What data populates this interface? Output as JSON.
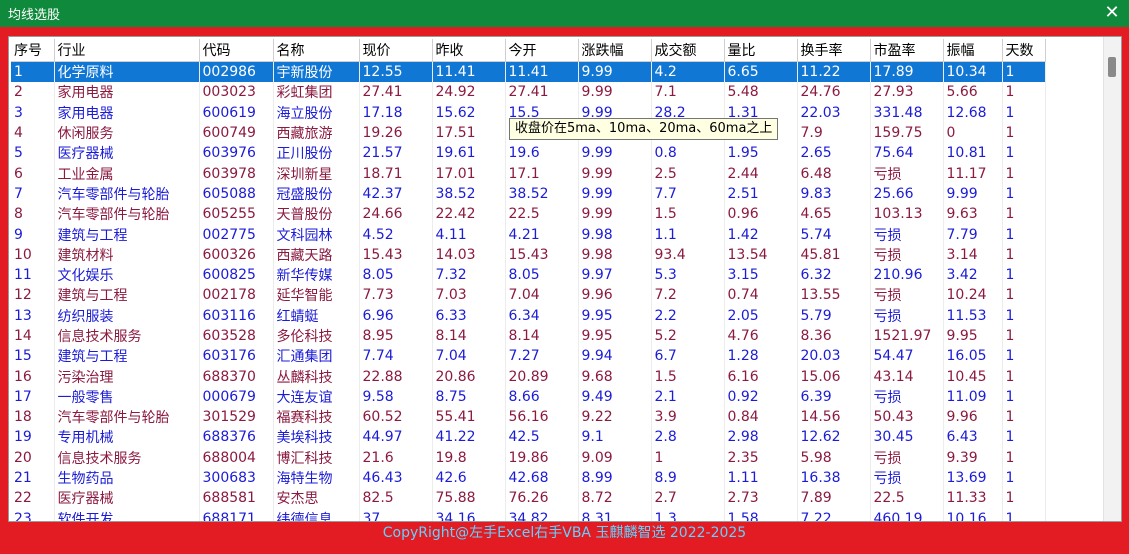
{
  "window": {
    "title": "均线选股"
  },
  "tooltip": "收盘价在5ma、10ma、20ma、60ma之上",
  "footer": "CopyRight@左手Excel右手VBA 玉麒麟智选  2022-2025",
  "columns": [
    "序号",
    "行业",
    "代码",
    "名称",
    "现价",
    "昨收",
    "今开",
    "涨跌幅",
    "成交额",
    "量比",
    "换手率",
    "市盈率",
    "振幅",
    "天数"
  ],
  "rows": [
    [
      "1",
      "化学原料",
      "002986",
      "宇新股份",
      "12.55",
      "11.41",
      "11.41",
      "9.99",
      "4.2",
      "6.65",
      "11.22",
      "17.89",
      "10.34",
      "1"
    ],
    [
      "2",
      "家用电器",
      "003023",
      "彩虹集团",
      "27.41",
      "24.92",
      "27.41",
      "9.99",
      "7.1",
      "5.48",
      "24.76",
      "27.93",
      "5.66",
      "1"
    ],
    [
      "3",
      "家用电器",
      "600619",
      "海立股份",
      "17.18",
      "15.62",
      "15.5",
      "9.99",
      "28.2",
      "1.31",
      "22.03",
      "331.48",
      "12.68",
      "1"
    ],
    [
      "4",
      "休闲服务",
      "600749",
      "西藏旅游",
      "19.26",
      "17.51",
      "1",
      "",
      "",
      "",
      "7.9",
      "159.75",
      "0",
      "1"
    ],
    [
      "5",
      "医疗器械",
      "603976",
      "正川股份",
      "21.57",
      "19.61",
      "19.6",
      "9.99",
      "0.8",
      "1.95",
      "2.65",
      "75.64",
      "10.81",
      "1"
    ],
    [
      "6",
      "工业金属",
      "603978",
      "深圳新星",
      "18.71",
      "17.01",
      "17.1",
      "9.99",
      "2.5",
      "2.44",
      "6.48",
      "亏损",
      "11.17",
      "1"
    ],
    [
      "7",
      "汽车零部件与轮胎",
      "605088",
      "冠盛股份",
      "42.37",
      "38.52",
      "38.52",
      "9.99",
      "7.7",
      "2.51",
      "9.83",
      "25.66",
      "9.99",
      "1"
    ],
    [
      "8",
      "汽车零部件与轮胎",
      "605255",
      "天普股份",
      "24.66",
      "22.42",
      "22.5",
      "9.99",
      "1.5",
      "0.96",
      "4.65",
      "103.13",
      "9.63",
      "1"
    ],
    [
      "9",
      "建筑与工程",
      "002775",
      "文科园林",
      "4.52",
      "4.11",
      "4.21",
      "9.98",
      "1.1",
      "1.42",
      "5.74",
      "亏损",
      "7.79",
      "1"
    ],
    [
      "10",
      "建筑材料",
      "600326",
      "西藏天路",
      "15.43",
      "14.03",
      "15.43",
      "9.98",
      "93.4",
      "13.54",
      "45.81",
      "亏损",
      "3.14",
      "1"
    ],
    [
      "11",
      "文化娱乐",
      "600825",
      "新华传媒",
      "8.05",
      "7.32",
      "8.05",
      "9.97",
      "5.3",
      "3.15",
      "6.32",
      "210.96",
      "3.42",
      "1"
    ],
    [
      "12",
      "建筑与工程",
      "002178",
      "延华智能",
      "7.73",
      "7.03",
      "7.04",
      "9.96",
      "7.2",
      "0.74",
      "13.55",
      "亏损",
      "10.24",
      "1"
    ],
    [
      "13",
      "纺织服装",
      "603116",
      "红蜻蜓",
      "6.96",
      "6.33",
      "6.34",
      "9.95",
      "2.2",
      "2.05",
      "5.79",
      "亏损",
      "11.53",
      "1"
    ],
    [
      "14",
      "信息技术服务",
      "603528",
      "多伦科技",
      "8.95",
      "8.14",
      "8.14",
      "9.95",
      "5.2",
      "4.76",
      "8.36",
      "1521.97",
      "9.95",
      "1"
    ],
    [
      "15",
      "建筑与工程",
      "603176",
      "汇通集团",
      "7.74",
      "7.04",
      "7.27",
      "9.94",
      "6.7",
      "1.28",
      "20.03",
      "54.47",
      "16.05",
      "1"
    ],
    [
      "16",
      "污染治理",
      "688370",
      "丛麟科技",
      "22.88",
      "20.86",
      "20.89",
      "9.68",
      "1.5",
      "6.16",
      "15.06",
      "43.14",
      "10.45",
      "1"
    ],
    [
      "17",
      "一般零售",
      "000679",
      "大连友谊",
      "9.58",
      "8.75",
      "8.66",
      "9.49",
      "2.1",
      "0.92",
      "6.39",
      "亏损",
      "11.09",
      "1"
    ],
    [
      "18",
      "汽车零部件与轮胎",
      "301529",
      "福赛科技",
      "60.52",
      "55.41",
      "56.16",
      "9.22",
      "3.9",
      "0.84",
      "14.56",
      "50.43",
      "9.96",
      "1"
    ],
    [
      "19",
      "专用机械",
      "688376",
      "美埃科技",
      "44.97",
      "41.22",
      "42.5",
      "9.1",
      "2.8",
      "2.98",
      "12.62",
      "30.45",
      "6.43",
      "1"
    ],
    [
      "20",
      "信息技术服务",
      "688004",
      "博汇科技",
      "21.6",
      "19.8",
      "19.86",
      "9.09",
      "1",
      "2.35",
      "5.98",
      "亏损",
      "9.39",
      "1"
    ],
    [
      "21",
      "生物药品",
      "300683",
      "海特生物",
      "46.43",
      "42.6",
      "42.68",
      "8.99",
      "8.9",
      "1.11",
      "16.38",
      "亏损",
      "13.69",
      "1"
    ],
    [
      "22",
      "医疗器械",
      "688581",
      "安杰思",
      "82.5",
      "75.88",
      "76.26",
      "8.72",
      "2.7",
      "2.73",
      "7.89",
      "22.5",
      "11.33",
      "1"
    ],
    [
      "23",
      "软件开发",
      "688171",
      "纬德信息",
      "37",
      "34.16",
      "34.82",
      "8.31",
      "1.3",
      "1.58",
      "7.22",
      "460.19",
      "10.16",
      "1"
    ]
  ]
}
